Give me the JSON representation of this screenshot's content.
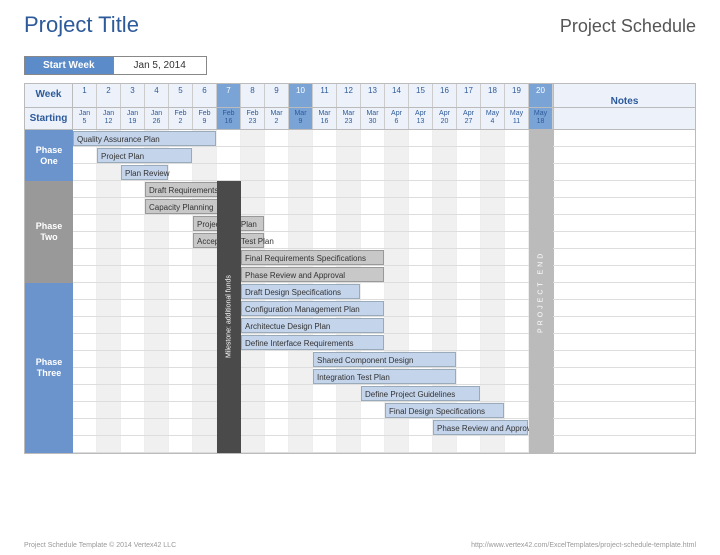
{
  "title": "Project Title",
  "subtitle": "Project Schedule",
  "start_week_label": "Start Week",
  "start_week_value": "Jan 5, 2014",
  "header_week_label": "Week",
  "header_starting_label": "Starting",
  "header_notes_label": "Notes",
  "weeks": [
    {
      "n": "1",
      "m": "Jan",
      "d": "5"
    },
    {
      "n": "2",
      "m": "Jan",
      "d": "12"
    },
    {
      "n": "3",
      "m": "Jan",
      "d": "19"
    },
    {
      "n": "4",
      "m": "Jan",
      "d": "26"
    },
    {
      "n": "5",
      "m": "Feb",
      "d": "2"
    },
    {
      "n": "6",
      "m": "Feb",
      "d": "9"
    },
    {
      "n": "7",
      "m": "Feb",
      "d": "16"
    },
    {
      "n": "8",
      "m": "Feb",
      "d": "23"
    },
    {
      "n": "9",
      "m": "Mar",
      "d": "2"
    },
    {
      "n": "10",
      "m": "Mar",
      "d": "9"
    },
    {
      "n": "11",
      "m": "Mar",
      "d": "16"
    },
    {
      "n": "12",
      "m": "Mar",
      "d": "23"
    },
    {
      "n": "13",
      "m": "Mar",
      "d": "30"
    },
    {
      "n": "14",
      "m": "Apr",
      "d": "6"
    },
    {
      "n": "15",
      "m": "Apr",
      "d": "13"
    },
    {
      "n": "16",
      "m": "Apr",
      "d": "20"
    },
    {
      "n": "17",
      "m": "Apr",
      "d": "27"
    },
    {
      "n": "18",
      "m": "May",
      "d": "4"
    },
    {
      "n": "19",
      "m": "May",
      "d": "11"
    },
    {
      "n": "20",
      "m": "May",
      "d": "18"
    }
  ],
  "phases": [
    {
      "label1": "Phase",
      "label2": "One",
      "color": "blue",
      "start_row": 0,
      "rows": 3
    },
    {
      "label1": "Phase",
      "label2": "Two",
      "color": "grey",
      "start_row": 3,
      "rows": 6
    },
    {
      "label1": "Phase",
      "label2": "Three",
      "color": "blue",
      "start_row": 9,
      "rows": 10
    }
  ],
  "chart_data": {
    "type": "gantt",
    "title": "Project Schedule",
    "xlabel": "Week",
    "x_range": [
      1,
      20
    ],
    "categories": [
      "Jan 5",
      "Jan 12",
      "Jan 19",
      "Jan 26",
      "Feb 2",
      "Feb 9",
      "Feb 16",
      "Feb 23",
      "Mar 2",
      "Mar 9",
      "Mar 16",
      "Mar 23",
      "Mar 30",
      "Apr 6",
      "Apr 13",
      "Apr 20",
      "Apr 27",
      "May 4",
      "May 11",
      "May 18"
    ],
    "milestones": [
      {
        "label": "Milestone: additional funds",
        "week": 7,
        "rows": [
          3,
          19
        ]
      },
      {
        "label": "PROJECT END",
        "week": 20,
        "rows": [
          0,
          19
        ]
      }
    ],
    "tasks": [
      {
        "name": "Quality Assurance Plan",
        "phase": "One",
        "start": 1,
        "end": 6,
        "row": 0,
        "color": "blue"
      },
      {
        "name": "Project Plan",
        "phase": "One",
        "start": 2,
        "end": 5,
        "row": 1,
        "color": "blue"
      },
      {
        "name": "Plan Review",
        "phase": "One",
        "start": 3,
        "end": 4,
        "row": 2,
        "color": "blue"
      },
      {
        "name": "Draft Requirements",
        "phase": "Two",
        "start": 4,
        "end": 7,
        "row": 3,
        "color": "grey"
      },
      {
        "name": "Capacity Planning",
        "phase": "Two",
        "start": 4,
        "end": 7,
        "row": 4,
        "color": "grey"
      },
      {
        "name": "Project Test Plan",
        "phase": "Two",
        "start": 6,
        "end": 8,
        "row": 5,
        "color": "grey"
      },
      {
        "name": "Acceptance Test Plan",
        "phase": "Two",
        "start": 6,
        "end": 8,
        "row": 6,
        "color": "grey"
      },
      {
        "name": "Final Requirements Specifications",
        "phase": "Two",
        "start": 8,
        "end": 13,
        "row": 7,
        "color": "grey"
      },
      {
        "name": "Phase Review and Approval",
        "phase": "Two",
        "start": 8,
        "end": 13,
        "row": 8,
        "color": "grey"
      },
      {
        "name": "Draft Design Specifications",
        "phase": "Three",
        "start": 8,
        "end": 12,
        "row": 9,
        "color": "blue"
      },
      {
        "name": "Configuration Management Plan",
        "phase": "Three",
        "start": 8,
        "end": 13,
        "row": 10,
        "color": "blue"
      },
      {
        "name": "Architectue Design Plan",
        "phase": "Three",
        "start": 8,
        "end": 13,
        "row": 11,
        "color": "blue"
      },
      {
        "name": "Define Interface Requirements",
        "phase": "Three",
        "start": 8,
        "end": 13,
        "row": 12,
        "color": "blue"
      },
      {
        "name": "Shared Component Design",
        "phase": "Three",
        "start": 11,
        "end": 16,
        "row": 13,
        "color": "blue"
      },
      {
        "name": "Integration Test Plan",
        "phase": "Three",
        "start": 11,
        "end": 16,
        "row": 14,
        "color": "blue"
      },
      {
        "name": "Define Project Guidelines",
        "phase": "Three",
        "start": 13,
        "end": 17,
        "row": 15,
        "color": "blue"
      },
      {
        "name": "Final Design Specifications",
        "phase": "Three",
        "start": 14,
        "end": 18,
        "row": 16,
        "color": "blue"
      },
      {
        "name": "Phase Review and Approval",
        "phase": "Three",
        "start": 16,
        "end": 19,
        "row": 17,
        "color": "blue"
      }
    ]
  },
  "footer_left": "Project Schedule Template © 2014 Vertex42 LLC",
  "footer_right": "http://www.vertex42.com/ExcelTemplates/project-schedule-template.html"
}
